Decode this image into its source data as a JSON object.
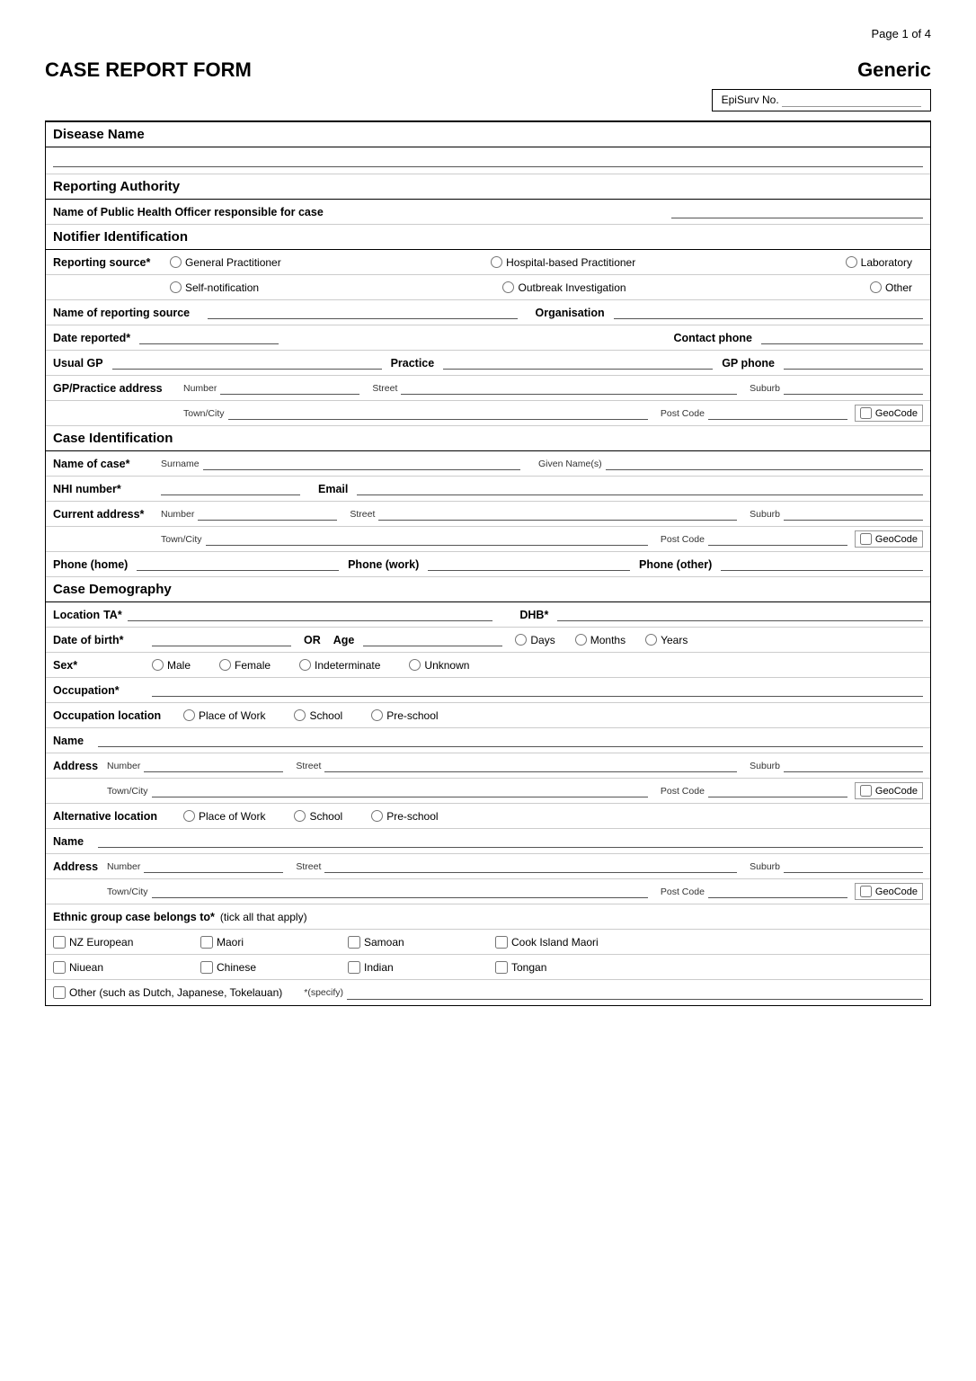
{
  "page": {
    "page_num": "Page 1 of 4",
    "form_title": "CASE REPORT FORM",
    "generic_label": "Generic",
    "episurv_label": "EpiSurv No."
  },
  "sections": {
    "disease_name": "Disease Name",
    "reporting_authority": "Reporting Authority",
    "notifier_id": "Notifier Identification",
    "case_id": "Case Identification",
    "case_demography": "Case Demography"
  },
  "labels": {
    "reporting_authority_officer": "Name of Public Health Officer responsible for case",
    "reporting_source": "Reporting source*",
    "general_practitioner": "General Practitioner",
    "hospital_based": "Hospital-based Practitioner",
    "laboratory": "Laboratory",
    "self_notification": "Self-notification",
    "outbreak_investigation": "Outbreak Investigation",
    "other": "Other",
    "name_reporting_source": "Name of reporting source",
    "organisation": "Organisation",
    "date_reported": "Date reported*",
    "contact_phone": "Contact phone",
    "usual_gp": "Usual GP",
    "practice": "Practice",
    "gp_phone": "GP phone",
    "gp_practice_address": "GP/Practice address",
    "number": "Number",
    "street": "Street",
    "suburb": "Suburb",
    "town_city": "Town/City",
    "post_code": "Post Code",
    "geocode": "GeoCode",
    "name_of_case": "Name of case*",
    "surname": "Surname",
    "given_names": "Given Name(s)",
    "nhi_number": "NHI number*",
    "email": "Email",
    "current_address": "Current address*",
    "phone_home": "Phone (home)",
    "phone_work": "Phone (work)",
    "phone_other": "Phone (other)",
    "location": "Location",
    "ta": "TA*",
    "dhb": "DHB*",
    "date_of_birth": "Date of birth*",
    "or": "OR",
    "age": "Age",
    "days": "Days",
    "months": "Months",
    "years": "Years",
    "sex": "Sex*",
    "male": "Male",
    "female": "Female",
    "indeterminate": "Indeterminate",
    "unknown": "Unknown",
    "occupation": "Occupation*",
    "occupation_location": "Occupation location",
    "place_of_work": "Place of Work",
    "school": "School",
    "pre_school": "Pre-school",
    "name": "Name",
    "address": "Address",
    "alternative_location": "Alternative location",
    "ethnic_group": "Ethnic group case belongs to*",
    "tick_all": "(tick all that apply)",
    "nz_european": "NZ European",
    "maori": "Maori",
    "samoan": "Samoan",
    "cook_island_maori": "Cook Island Maori",
    "niuean": "Niuean",
    "chinese": "Chinese",
    "indian": "Indian",
    "tongan": "Tongan",
    "other_specify": "Other (such as Dutch, Japanese, Tokelauan)",
    "specify": "*(specify)"
  }
}
